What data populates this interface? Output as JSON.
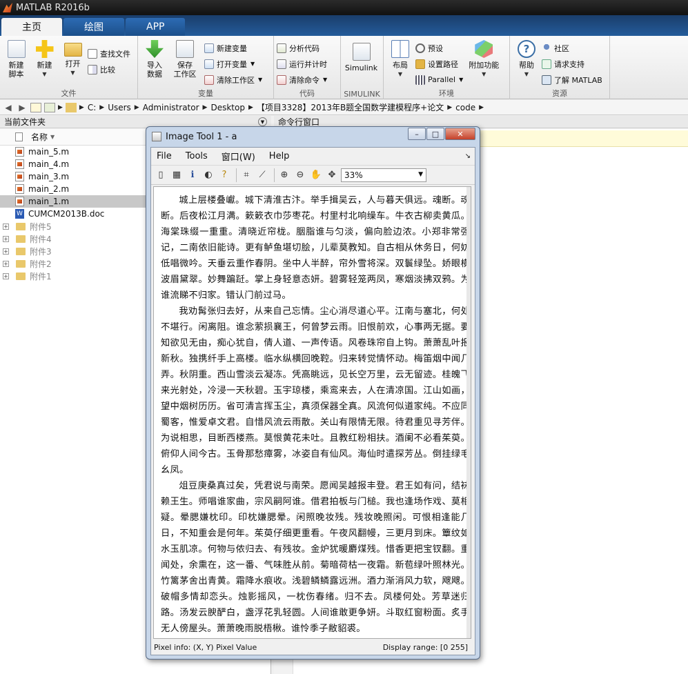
{
  "app_title": "MATLAB R2016b",
  "tabs": [
    "主页",
    "绘图",
    "APP"
  ],
  "ribbon": {
    "file": {
      "new_script": "新建\n脚本",
      "new": "新建",
      "open": "打开",
      "find_files": "查找文件",
      "compare": "比较",
      "label": "文件"
    },
    "variable": {
      "import": "导入\n数据",
      "save_ws": "保存\n工作区",
      "new_var": "新建变量",
      "open_var": "打开变量",
      "clear_ws": "清除工作区",
      "label": "变量"
    },
    "code": {
      "analyze": "分析代码",
      "run_time": "运行并计时",
      "clear_cmd": "清除命令",
      "label": "代码"
    },
    "simulink": {
      "simulink": "Simulink",
      "label": "SIMULINK"
    },
    "env": {
      "layout": "布局",
      "prefs": "预设",
      "set_path": "设置路径",
      "parallel": "Parallel",
      "addons": "附加功能",
      "label": "环境"
    },
    "resources": {
      "help": "帮助",
      "community": "社区",
      "support": "请求支持",
      "learn": "了解 MATLAB",
      "label": "资源"
    }
  },
  "address": [
    "C:",
    "Users",
    "Administrator",
    "Desktop",
    "【项目3328】2013年B题全国数学建模程序+论文",
    "code"
  ],
  "current_folder": {
    "header": "当前文件夹",
    "column_name": "名称",
    "files": [
      {
        "name": "main_5.m",
        "type": "m"
      },
      {
        "name": "main_4.m",
        "type": "m"
      },
      {
        "name": "main_3.m",
        "type": "m"
      },
      {
        "name": "main_2.m",
        "type": "m"
      },
      {
        "name": "main_1.m",
        "type": "m",
        "selected": true
      },
      {
        "name": "CUMCM2013B.doc",
        "type": "doc"
      }
    ],
    "folders": [
      "附件5",
      "附件4",
      "附件3",
      "附件2",
      "附件1"
    ]
  },
  "command_window": {
    "header": "命令行窗口"
  },
  "image_tool": {
    "title": "Image Tool 1 - a",
    "menus": [
      "File",
      "Tools",
      "窗口(W)",
      "Help"
    ],
    "zoom": "33%",
    "pixel_info": "Pixel info: (X, Y)  Pixel Value",
    "display_range": "Display range: [0 255]",
    "paragraphs": [
      "城上层楼叠巘。城下清淮古汴。举手揖吴云，人与暮天俱远。魂断。魂断。后夜松江月满。簌簌衣巾莎枣花。村里村北响缲车。牛衣古柳卖黄瓜。海棠珠缀一重重。清晓近帘栊。胭脂谁与匀淡，偏向脸边浓。小郑非常强记，二南依旧能诗。更有鲈鱼堪切脍，儿辈莫教知。自古相从休务日，何妨低唱微吟。天垂云重作春阴。坐中人半醉，帘外雪将深。双鬟绿坠。娇眼横波眉黛翠。妙舞蹁跹。掌上身轻意态妍。碧雾轻笼两凤，寒烟淡拂双鸦。为谁流睇不归家。错认门前过马。",
      "我劝髯张归去好，从来自己忘情。尘心消尽道心平。江南与塞北，何处不堪行。闲离阻。谁念萦损襄王，何曾梦云雨。旧恨前欢，心事两无据。要知欲见无由，痴心犹自，倩人道、一声传语。风卷珠帘自上钩。萧萧乱叶报新秋。独携纤手上高楼。临水纵横回晚鞚。归来转觉情怀动。梅笛烟中闻几弄。秋阴重。西山雪淡云凝冻。凭高眺远，见长空万里，云无留迹。桂魄飞来光射处，冷浸一天秋碧。玉宇琼楼，乘鸾来去，人在清凉国。江山如画，望中烟树历历。省可清言挥玉尘，真须保器全真。风流何似道家纯。不应同蜀客，惟爱卓文君。自惜风流云雨散。关山有限情无限。待君重见寻芳伴。为说相思，目断西楼燕。莫恨黄花未吐。且教红粉相扶。酒阑不必看茱萸。俯仰人间今古。玉骨那愁瘴雾，冰姿自有仙风。海仙时遣探芳丛。倒挂绿毛幺凤。",
      "俎豆庚桑真过矣，凭君说与南荣。愿闻吴越报丰登。君王如有问，结袜赖王生。师唱谁家曲，宗风嗣阿谁。借君拍板与门槌。我也逢场作戏、莫相疑。晕腮嫌枕印。印枕嫌腮晕。闲照晚妆残。残妆晚照闲。可恨相逢能几日，不知重会是何年。茱萸仔细更重看。午夜风翻幔，三更月到床。簟纹如水玉肌凉。何物与侬归去、有残妆。金炉犹暖麝煤残。惜香更把宝钗翻。重闻处，余熏在，这一番、气味胜从前。菊暗荷枯一夜霜。新苞绿叶照林光。竹篱茅舍出青黄。霜降水痕收。浅碧鳞鳞露远洲。酒力渐消风力软，飕飕。破帽多情却恋头。烛影摇风，一枕伤春绪。归不去。凤楼何处。芳草迷归路。汤发云腴酽白，盏浮花乳轻圆。人间谁敢更争妍。斗取红窗粉面。炙手无人傍屋头。萧萧晚雨脱梧楸。谁怜季子敝貂裘。"
    ]
  }
}
